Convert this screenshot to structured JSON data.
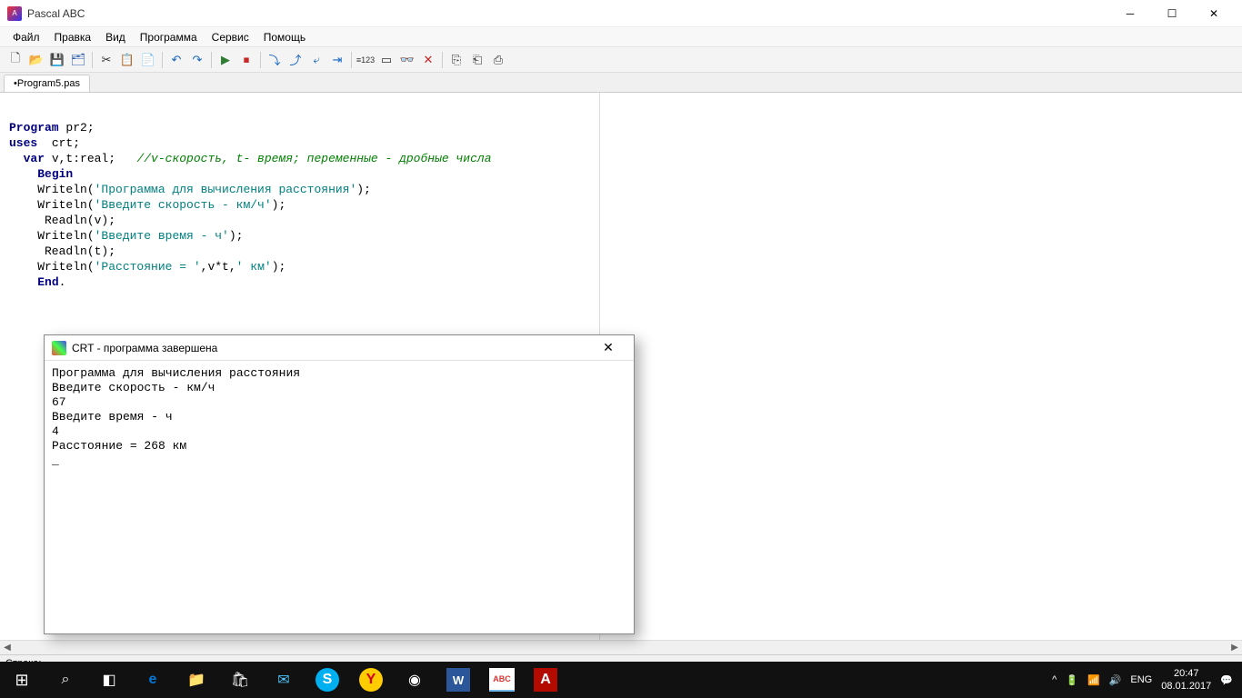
{
  "window": {
    "title": "Pascal ABC"
  },
  "menu": {
    "file": "Файл",
    "edit": "Правка",
    "view": "Вид",
    "program": "Программа",
    "service": "Сервис",
    "help": "Помощь"
  },
  "tab": {
    "name": "•Program5.pas"
  },
  "code": {
    "l1_kw": "Program",
    "l1_rest": " pr2;",
    "l2_kw": "uses",
    "l2_rest": "  crt;",
    "l3_pad": "  ",
    "l3_kw": "var",
    "l3_rest": " v,t:real;   ",
    "l3_cm": "//v-скорость, t- время; переменные - дробные числа",
    "l4_pad": "    ",
    "l4_kw": "Begin",
    "l5_pad": "    Writeln(",
    "l5_str": "'Программа для вычисления расстояния'",
    "l5_end": ");",
    "l6_pad": "    Writeln(",
    "l6_str": "'Введите скорость - км/ч'",
    "l6_end": ");",
    "l7": "     Readln(v);",
    "l8_pad": "    Writeln(",
    "l8_str": "'Введите время - ч'",
    "l8_end": ");",
    "l9": "     Readln(t);",
    "l10_pad": "    Writeln(",
    "l10_str": "'Расстояние = '",
    "l10_mid": ",v*t,",
    "l10_str2": "' км'",
    "l10_end": ");",
    "l11_pad": "    ",
    "l11_kw": "End",
    "l11_rest": "."
  },
  "crt": {
    "title": "CRT - программа завершена",
    "output": "Программа для вычисления расстояния\nВведите скорость - км/ч\n67\nВведите время - ч\n4\nРасстояние = 268 км\n_"
  },
  "status": {
    "line_label": "Строка:"
  },
  "tray": {
    "lang": "ENG",
    "time": "20:47",
    "date": "08.01.2017"
  },
  "icons": {
    "new": "🗋",
    "open": "📂",
    "save": "💾",
    "saveall": "🗂",
    "cut": "✂",
    "copy": "📋",
    "paste": "📄",
    "undo": "↶",
    "redo": "↷",
    "run": "▶",
    "stop": "⏹",
    "step1": "⤵",
    "step2": "⤴",
    "step3": "⤶",
    "step4": "⇥",
    "vars": "≡123",
    "window": "▭",
    "watch": "👓",
    "clear": "✕",
    "out1": "⎘",
    "out2": "⎗",
    "out3": "⎙"
  },
  "taskbar_icons": {
    "start": "⊞",
    "search": "⌕",
    "taskview": "◧",
    "edge": "e",
    "explorer": "📁",
    "store": "🛍",
    "mail": "✉",
    "skype": "S",
    "yandex": "Y",
    "chrome": "◉",
    "word": "W",
    "pascal": "ABC",
    "acrobat": "A"
  },
  "tray_icons": {
    "up": "^",
    "battery": "🔋",
    "net": "📶",
    "vol": "🔊",
    "notify": "💬"
  }
}
